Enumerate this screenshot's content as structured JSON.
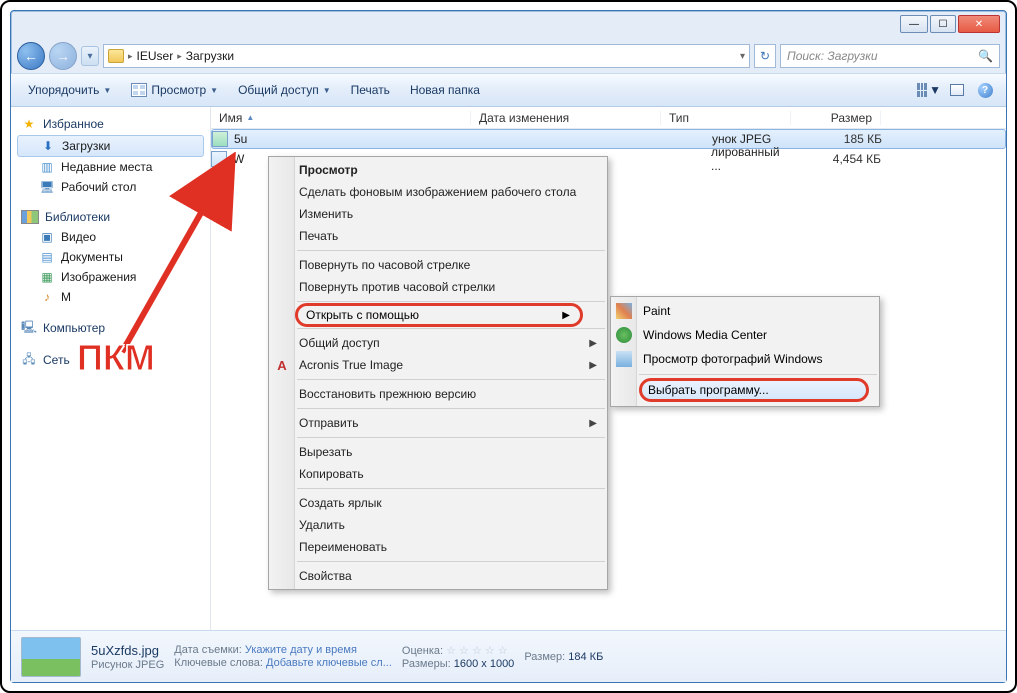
{
  "titlebar": {
    "min": "—",
    "max": "☐",
    "close": "✕"
  },
  "nav": {
    "back": "←",
    "fwd": "→",
    "drop": "▾",
    "refresh": "↻"
  },
  "address": {
    "crumb1": "IEUser",
    "crumb2": "Загрузки",
    "sep": "▸"
  },
  "search": {
    "placeholder": "Поиск: Загрузки",
    "icon": "🔍"
  },
  "toolbar": {
    "organize": "Упорядочить",
    "preview": "Просмотр",
    "share": "Общий доступ",
    "print": "Печать",
    "newfolder": "Новая папка",
    "drop": "▼",
    "help": "?"
  },
  "sidebar": {
    "fav": "Избранное",
    "downloads": "Загрузки",
    "recent": "Недавние места",
    "desktop": "Рабочий стол",
    "libs": "Библиотеки",
    "video": "Видео",
    "docs": "Документы",
    "images": "Изображения",
    "music": "М",
    "computer": "Компьютер",
    "network": "Сеть"
  },
  "columns": {
    "name": "Имя",
    "date": "Дата изменения",
    "type": "Тип",
    "size": "Размер",
    "sort": "▲"
  },
  "files": [
    {
      "name": "5u",
      "type_tail": "унок JPEG",
      "size": "185 КБ"
    },
    {
      "name": "W",
      "type_tail": "лированный ...",
      "size": "4,454 КБ"
    }
  ],
  "ctx": {
    "preview": "Просмотр",
    "set_wallpaper": "Сделать фоновым изображением рабочего стола",
    "edit": "Изменить",
    "print": "Печать",
    "rotate_cw": "Повернуть по часовой стрелке",
    "rotate_ccw": "Повернуть против часовой стрелки",
    "open_with": "Открыть с помощью",
    "share": "Общий доступ",
    "acronis": "Acronis True Image",
    "restore": "Восстановить прежнюю версию",
    "send_to": "Отправить",
    "cut": "Вырезать",
    "copy": "Копировать",
    "shortcut": "Создать ярлык",
    "delete": "Удалить",
    "rename": "Переименовать",
    "properties": "Свойства",
    "arrow": "▶"
  },
  "submenu": {
    "paint": "Paint",
    "wmc": "Windows Media Center",
    "photo": "Просмотр фотографий Windows",
    "choose": "Выбрать программу..."
  },
  "details": {
    "filename": "5uXzfds.jpg",
    "filetype": "Рисунок JPEG",
    "date_l": "Дата съемки:",
    "date_v": "Укажите дату и время",
    "tags_l": "Ключевые слова:",
    "tags_v": "Добавьте ключевые сл...",
    "rating_l": "Оценка:",
    "rating_v": "☆ ☆ ☆ ☆ ☆",
    "dim_l": "Размеры:",
    "dim_v": "1600 x 1000",
    "size_l": "Размер:",
    "size_v": "184 КБ"
  },
  "overlay": {
    "pkm": "ПКМ"
  }
}
